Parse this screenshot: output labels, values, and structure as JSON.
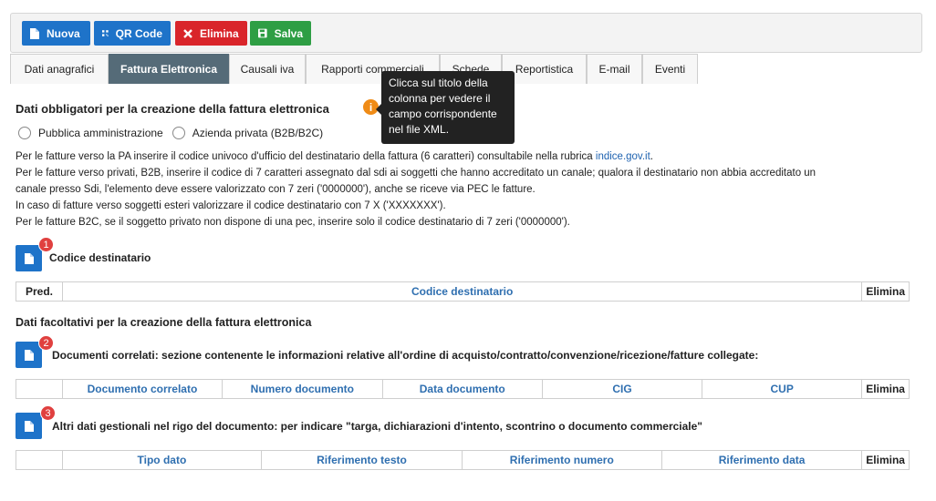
{
  "toolbar": {
    "nuova": "Nuova",
    "qr_code": "QR Code",
    "elimina": "Elimina",
    "salva": "Salva"
  },
  "tabs": [
    {
      "label": "Dati anagrafici"
    },
    {
      "label": "Fattura Elettronica"
    },
    {
      "label": "Causali iva"
    },
    {
      "label": "Rapporti commerciali"
    },
    {
      "label": "Schede"
    },
    {
      "label": "Reportistica"
    },
    {
      "label": "E-mail"
    },
    {
      "label": "Eventi"
    }
  ],
  "mandatory": {
    "title": "Dati obbligatori per la creazione della fattura elettronica",
    "tooltip": "Clicca sul titolo della colonna per vedere il campo corrispondente nel file XML.",
    "radio_pa": "Pubblica amministrazione",
    "radio_private": "Azienda privata (B2B/B2C)",
    "notes": {
      "line1": "Per le fatture verso la PA inserire il codice univoco d'ufficio del destinatario della fattura (6 caratteri) consultabile nella rubrica",
      "line1_link": "indice.gov.it",
      "line1_end": ".",
      "line2": "Per le fatture verso privati, B2B, inserire il codice di 7 caratteri assegnato dal sdi ai soggetti che hanno accreditato un canale; qualora il destinatario non abbia accreditato un",
      "line3": "canale presso Sdi, l'elemento deve essere valorizzato con 7 zeri ('0000000'), anche se riceve via PEC le fatture.",
      "line4": "In caso di fatture verso soggetti esteri valorizzare il codice destinatario con 7 X ('XXXXXXX').",
      "line5": "Per le fatture B2C, se il soggetto privato non dispone di una pec, inserire solo il codice destinatario di 7 zeri ('0000000')."
    }
  },
  "section1": {
    "badge": "1",
    "label": "Codice destinatario",
    "columns": [
      "Pred.",
      "Codice destinatario",
      "Elimina"
    ]
  },
  "optional": {
    "title": "Dati facoltativi per la creazione della fattura elettronica"
  },
  "section2": {
    "badge": "2",
    "label": "Documenti correlati: sezione contenente le informazioni relative all'ordine di acquisto/contratto/convenzione/ricezione/fatture collegate:",
    "columns": [
      "",
      "Documento correlato",
      "Numero documento",
      "Data documento",
      "CIG",
      "CUP",
      "Elimina"
    ]
  },
  "section3": {
    "badge": "3",
    "label": "Altri dati gestionali nel rigo del documento: per indicare \"targa, dichiarazioni d'intento, scontrino o documento commerciale\"",
    "columns": [
      "",
      "Tipo dato",
      "Riferimento testo",
      "Riferimento numero",
      "Riferimento data",
      "Elimina"
    ]
  },
  "colors": {
    "primary": "#1e73c9",
    "danger": "#d9252a",
    "success": "#2e9e44",
    "tab_active": "#556b78",
    "badge": "#e0403f",
    "info": "#ef8b16",
    "header_link": "#2f6fb0"
  }
}
